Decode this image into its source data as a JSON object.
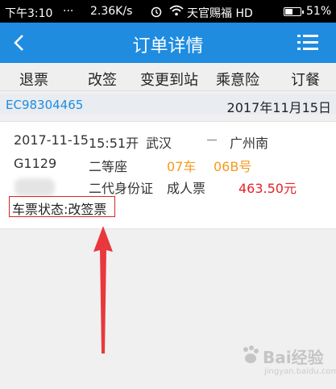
{
  "status_bar": {
    "time": "下午3:10",
    "dots": "...",
    "speed": "2.36K/s",
    "carrier": "天官赐福 HD",
    "battery": "51%",
    "battery_level": 0.51
  },
  "header": {
    "title": "订单详情"
  },
  "actions": [
    "退票",
    "改签",
    "变更到站",
    "乘意险",
    "订餐"
  ],
  "order": {
    "number": "EC98304465",
    "date": "2017年11月15日"
  },
  "ticket": {
    "date": "2017-11-15",
    "time": "15:51开",
    "from": "武汉",
    "to": "广州南",
    "train": "G1129",
    "seat_class": "二等座",
    "car": "07车",
    "seat": "06B号",
    "id_type": "二代身份证",
    "ticket_type": "成人票",
    "price": "463.50元",
    "status": "车票状态:改签票"
  },
  "watermark": {
    "brand": "Bai经验",
    "sub": "jingyan.baidu.com"
  }
}
